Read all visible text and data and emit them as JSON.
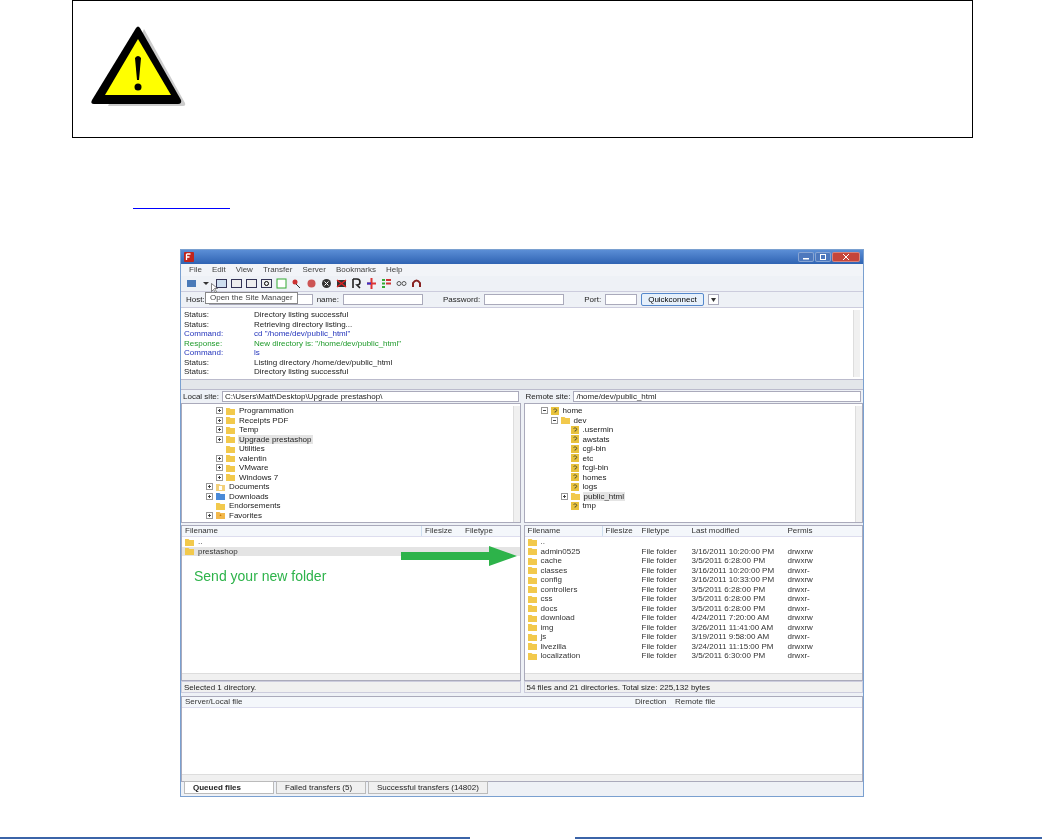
{
  "window": {
    "menu": [
      "File",
      "Edit",
      "View",
      "Transfer",
      "Server",
      "Bookmarks",
      "Help"
    ],
    "tooltip": "Open the Site Manager",
    "quickconnect": {
      "host_label": "Host:",
      "username_label": "name:",
      "password_label": "Password:",
      "port_label": "Port:",
      "button": "Quickconnect"
    },
    "log": [
      {
        "kind": "status",
        "label": "Status:",
        "message": "Directory listing successful"
      },
      {
        "kind": "status",
        "label": "Status:",
        "message": "Retrieving directory listing..."
      },
      {
        "kind": "command",
        "label": "Command:",
        "message": "cd \"/home/dev/public_html\""
      },
      {
        "kind": "response",
        "label": "Response:",
        "message": "New directory is: \"/home/dev/public_html\""
      },
      {
        "kind": "command",
        "label": "Command:",
        "message": "ls"
      },
      {
        "kind": "status",
        "label": "Status:",
        "message": "Listing directory /home/dev/public_html"
      },
      {
        "kind": "status",
        "label": "Status:",
        "message": "Directory listing successful"
      }
    ],
    "local": {
      "site_label": "Local site:",
      "path": "C:\\Users\\Matt\\Desktop\\Upgrade prestashop\\",
      "tree": [
        {
          "children": [
            {
              "label": "Programmation",
              "kind": "folder",
              "expandable": true,
              "selected": false
            },
            {
              "label": "Receipts PDF",
              "kind": "folder",
              "expandable": true,
              "selected": false
            },
            {
              "label": "Temp",
              "kind": "folder",
              "expandable": true,
              "selected": false
            },
            {
              "label": "Upgrade prestashop",
              "kind": "folder",
              "expandable": true,
              "selected": true
            },
            {
              "label": "Utilities",
              "kind": "folder",
              "expandable": false,
              "selected": false
            },
            {
              "label": "valentin",
              "kind": "folder",
              "expandable": true,
              "selected": false
            },
            {
              "label": "VMware",
              "kind": "folder",
              "expandable": true,
              "selected": false
            },
            {
              "label": "Windows 7",
              "kind": "folder",
              "expandable": true,
              "selected": false
            }
          ]
        },
        {
          "label": "Documents",
          "kind": "documents",
          "expandable": true,
          "selected": false
        },
        {
          "label": "Downloads",
          "kind": "downloads",
          "expandable": true,
          "selected": false
        },
        {
          "label": "Endorsements",
          "kind": "folder",
          "expandable": false,
          "selected": false
        },
        {
          "label": "Favorites",
          "kind": "favorites",
          "expandable": true,
          "selected": false
        }
      ],
      "columns": [
        "Filename",
        "Filesize",
        "Filetype"
      ],
      "rows": [
        {
          "name": "..",
          "selected": false
        },
        {
          "name": "prestashop",
          "selected": true
        }
      ],
      "status": "Selected 1 directory."
    },
    "annotation": "Send your new folder",
    "remote": {
      "site_label": "Remote site:",
      "path": "/home/dev/public_html",
      "tree": [
        {
          "label": "home",
          "kind": "unknown",
          "expandable": true,
          "selected": false,
          "children": [
            {
              "label": "dev",
              "kind": "folder",
              "expandable": true,
              "selected": false,
              "children": [
                {
                  "label": ".usermin",
                  "kind": "unknown",
                  "expandable": false,
                  "selected": false
                },
                {
                  "label": "awstats",
                  "kind": "unknown",
                  "expandable": false,
                  "selected": false
                },
                {
                  "label": "cgi-bin",
                  "kind": "unknown",
                  "expandable": false,
                  "selected": false
                },
                {
                  "label": "etc",
                  "kind": "unknown",
                  "expandable": false,
                  "selected": false
                },
                {
                  "label": "fcgi-bin",
                  "kind": "unknown",
                  "expandable": false,
                  "selected": false
                },
                {
                  "label": "homes",
                  "kind": "unknown",
                  "expandable": false,
                  "selected": false
                },
                {
                  "label": "logs",
                  "kind": "unknown",
                  "expandable": false,
                  "selected": false
                },
                {
                  "label": "public_html",
                  "kind": "folder",
                  "expandable": true,
                  "selected": true
                },
                {
                  "label": "tmp",
                  "kind": "unknown",
                  "expandable": false,
                  "selected": false
                }
              ]
            }
          ]
        }
      ],
      "columns": [
        "Filename",
        "Filesize",
        "Filetype",
        "Last modified",
        "Permis"
      ],
      "rows": [
        {
          "name": ".."
        },
        {
          "name": "admin0525",
          "type": "File folder",
          "modified": "3/16/2011 10:20:00 PM",
          "perms": "drwxrw"
        },
        {
          "name": "cache",
          "type": "File folder",
          "modified": "3/5/2011 6:28:00 PM",
          "perms": "drwxrw"
        },
        {
          "name": "classes",
          "type": "File folder",
          "modified": "3/16/2011 10:20:00 PM",
          "perms": "drwxr-"
        },
        {
          "name": "config",
          "type": "File folder",
          "modified": "3/16/2011 10:33:00 PM",
          "perms": "drwxrw"
        },
        {
          "name": "controllers",
          "type": "File folder",
          "modified": "3/5/2011 6:28:00 PM",
          "perms": "drwxr-"
        },
        {
          "name": "css",
          "type": "File folder",
          "modified": "3/5/2011 6:28:00 PM",
          "perms": "drwxr-"
        },
        {
          "name": "docs",
          "type": "File folder",
          "modified": "3/5/2011 6:28:00 PM",
          "perms": "drwxr-"
        },
        {
          "name": "download",
          "type": "File folder",
          "modified": "4/24/2011 7:20:00 AM",
          "perms": "drwxrw"
        },
        {
          "name": "img",
          "type": "File folder",
          "modified": "3/26/2011 11:41:00 AM",
          "perms": "drwxrw"
        },
        {
          "name": "js",
          "type": "File folder",
          "modified": "3/19/2011 9:58:00 AM",
          "perms": "drwxr-"
        },
        {
          "name": "livezilla",
          "type": "File folder",
          "modified": "3/24/2011 11:15:00 PM",
          "perms": "drwxrw"
        },
        {
          "name": "localization",
          "type": "File folder",
          "modified": "3/5/2011 6:30:00 PM",
          "perms": "drwxr-"
        }
      ],
      "status": "54 files and 21 directories. Total size: 225,132 bytes"
    },
    "queue": {
      "columns": [
        "Server/Local file",
        "Direction",
        "Remote file"
      ],
      "tabs": [
        {
          "label": "Queued files",
          "selected": true
        },
        {
          "label": "Failed transfers (5)",
          "selected": false
        },
        {
          "label": "Successful transfers (14802)",
          "selected": false
        }
      ]
    }
  }
}
